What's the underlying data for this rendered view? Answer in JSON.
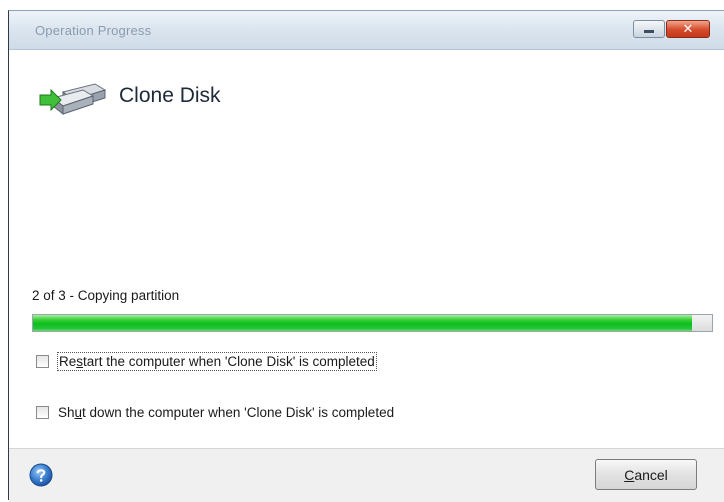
{
  "window": {
    "title": "Operation Progress",
    "minimize_icon": "minimize-icon",
    "close_icon": "close-icon",
    "close_glyph": "✕"
  },
  "header": {
    "title": "Clone Disk",
    "icon": "clone-disk-icon"
  },
  "operation": {
    "status": "2 of 3 - Copying partition",
    "progress_fraction": 0.97
  },
  "options": [
    {
      "label_before": "Re",
      "label_mnemonic": "s",
      "label_after": "tart the computer when 'Clone Disk' is completed",
      "checked": false
    },
    {
      "label_before": "Sh",
      "label_mnemonic": "u",
      "label_after": "t down the computer when 'Clone Disk' is completed",
      "checked": false
    }
  ],
  "footer": {
    "help_icon": "help-icon",
    "cancel_mnemonic": "C",
    "cancel_rest": "ancel"
  },
  "colors": {
    "progress_green": "#0bbf1d",
    "close_red": "#d54b2a"
  }
}
